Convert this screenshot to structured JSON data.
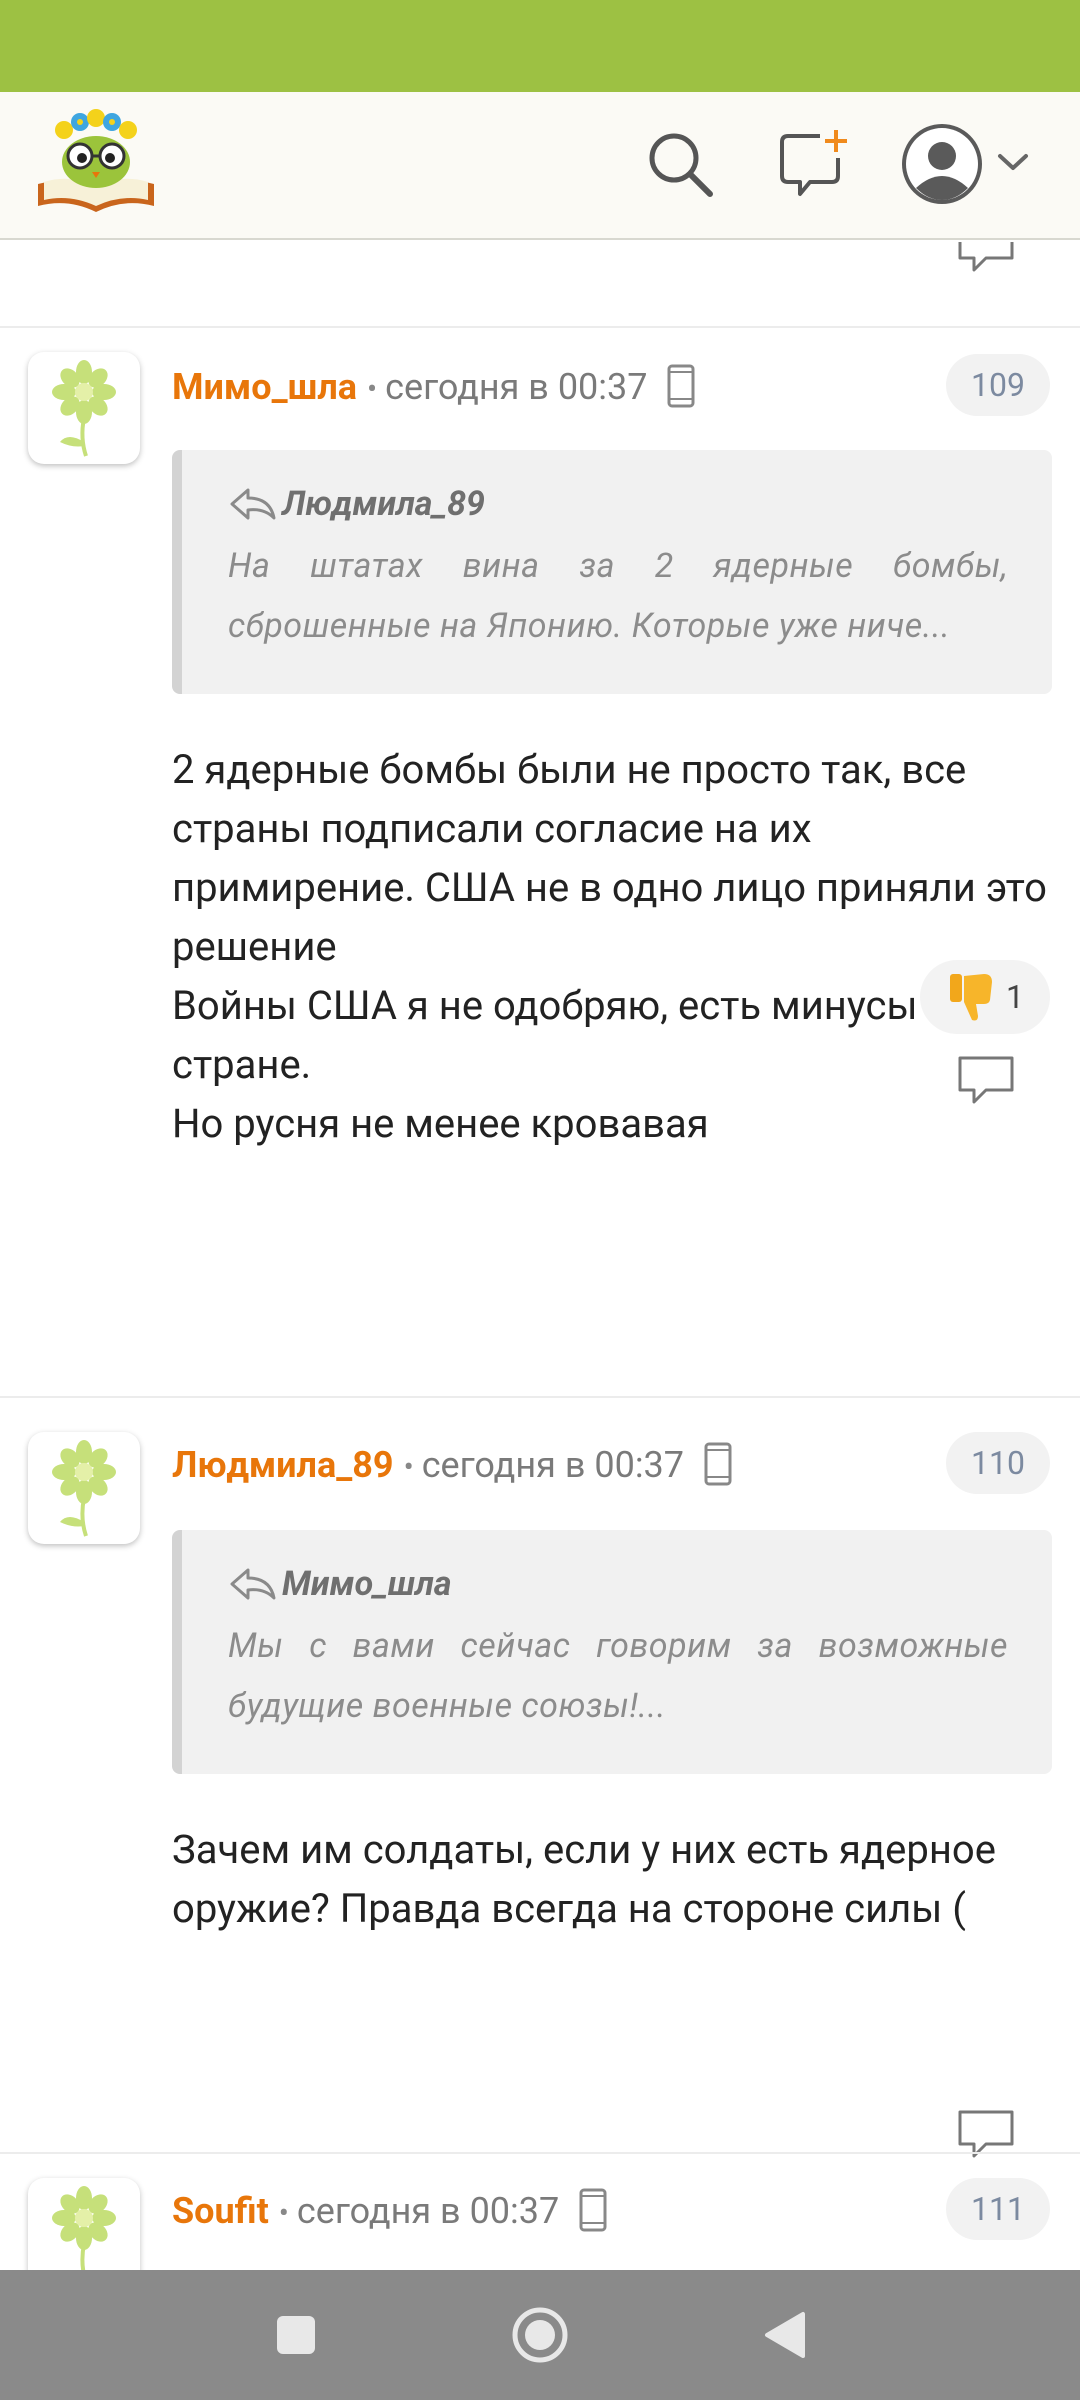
{
  "app": {
    "logo_icon": "owl-reading-book-logo",
    "accent_color": "#9dc143",
    "author_color": "#e8760a"
  },
  "header": {
    "search_icon": "search-icon",
    "new_message_icon": "new-message-icon",
    "profile_icon": "user-avatar-icon"
  },
  "comments": [
    {
      "author": "Мимо_шла",
      "time": "сегодня в 00:37",
      "number": "109",
      "quote_author": "Людмила_89",
      "quote_text": "На штатах вина за 2 ядерные бомбы, сброшенные на Японию. Которые уже ниче...",
      "body": "2 ядерные бомбы были не просто так, все страны подписали согласие на их примирение. США не в одно лицо приняли это решение\nВойны США я не одобряю, есть минусы в этой стране.\nНо русня не менее кровавая",
      "vote_count": "1"
    },
    {
      "author": "Людмила_89",
      "time": "сегодня в 00:37",
      "number": "110",
      "quote_author": "Мимо_шла",
      "quote_text": "Мы с вами сейчас говорим за возможные будущие военные союзы!...",
      "body": "Зачем им солдаты, если у них есть ядерное оружие? Правда всегда на стороне силы ("
    },
    {
      "author": "Soufit",
      "time": "сегодня в 00:37",
      "number": "111"
    }
  ]
}
